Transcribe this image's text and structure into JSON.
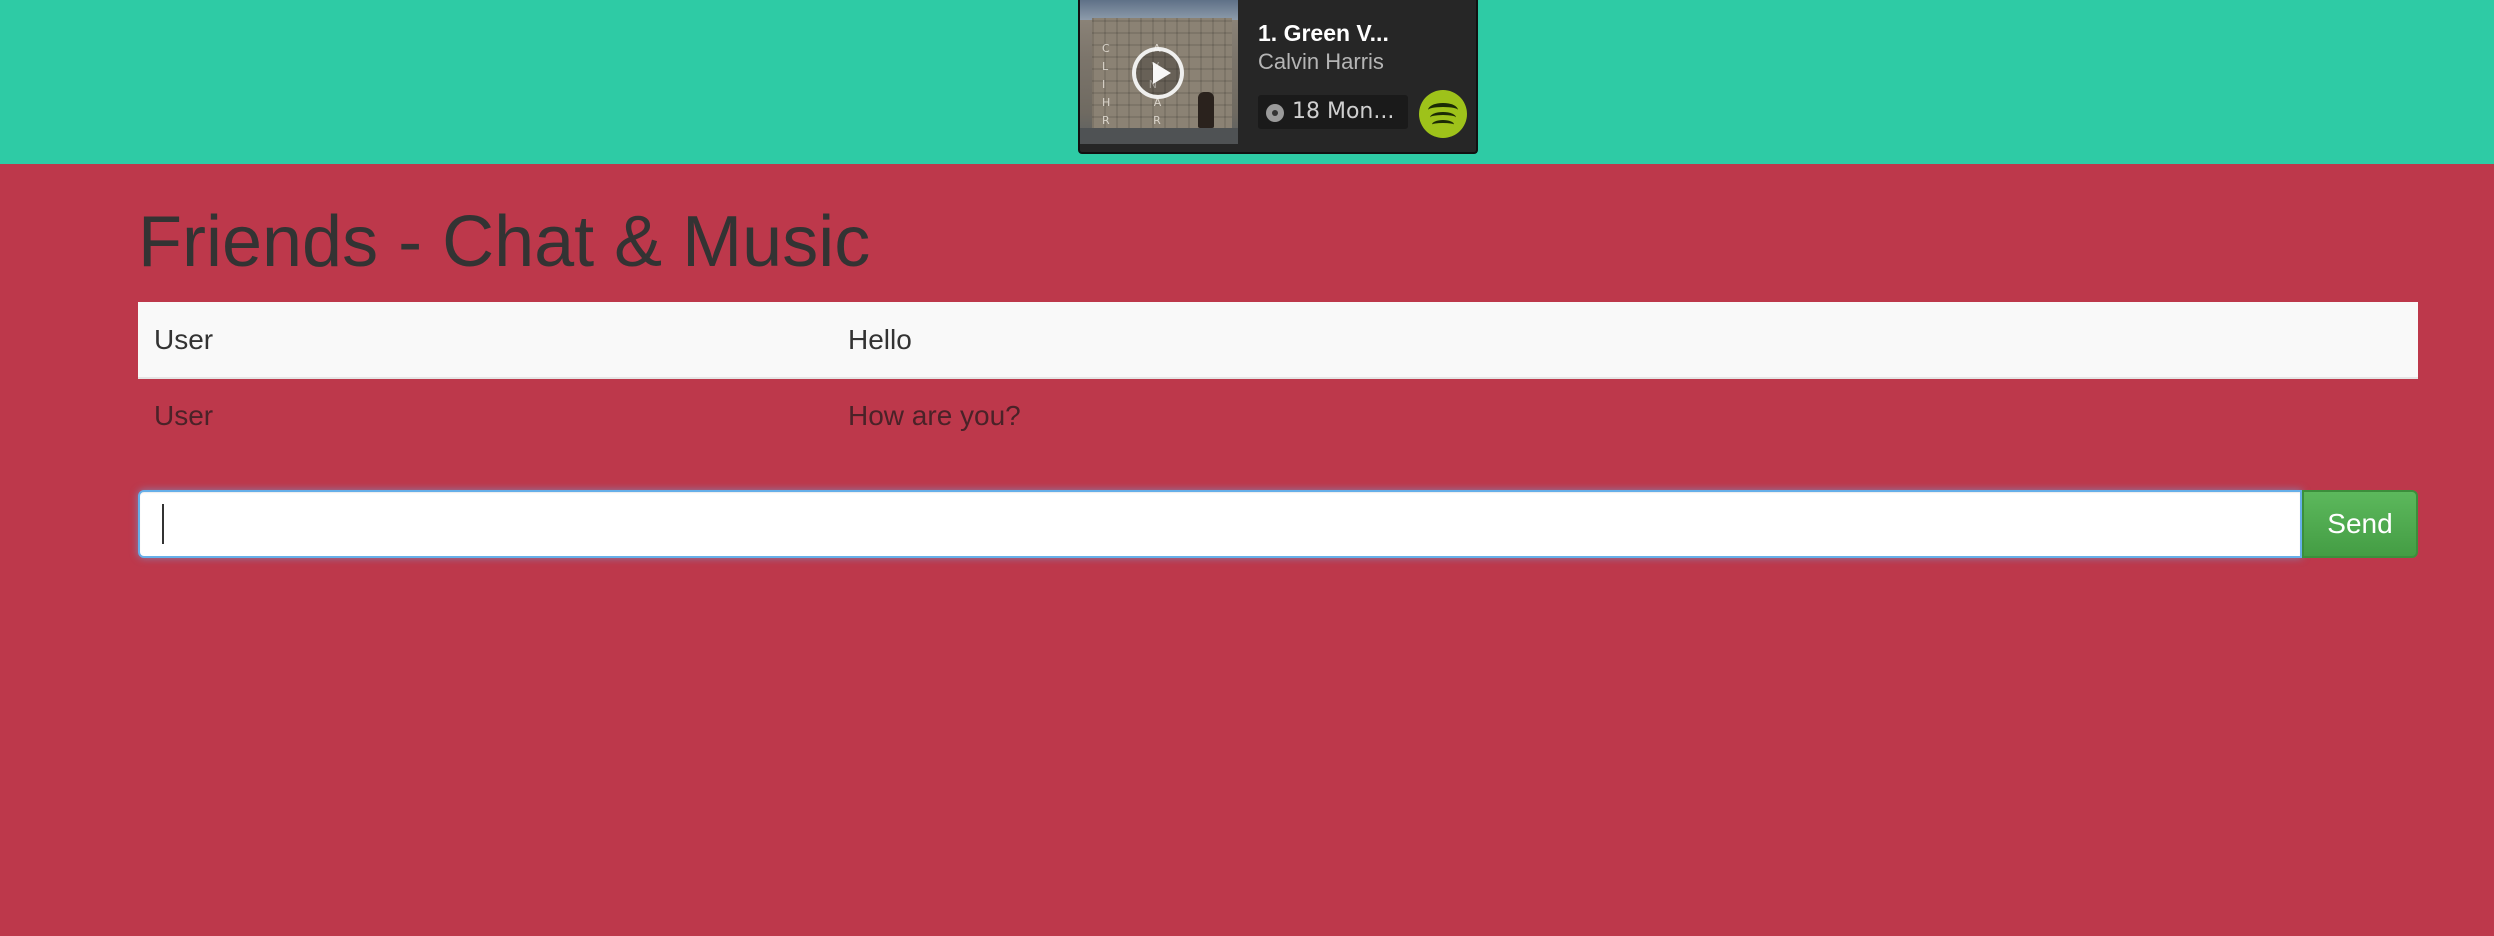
{
  "player": {
    "track_title": "1. Green V...",
    "artist": "Calvin Harris",
    "album": "18 Mon...",
    "cover_letters": "C A L V I N H A R R I S"
  },
  "page": {
    "title": "Friends - Chat & Music"
  },
  "messages": [
    {
      "user": "User",
      "text": "Hello"
    },
    {
      "user": "User",
      "text": "How are you?"
    }
  ],
  "composer": {
    "input_value": "",
    "send_label": "Send"
  },
  "colors": {
    "top_bar": "#2ecba5",
    "page_background": "#bd384b",
    "send_button": "#5cb85c",
    "spotify_badge": "#9ec21a"
  },
  "icons": [
    "play-icon",
    "disc-icon",
    "spotify-icon"
  ]
}
